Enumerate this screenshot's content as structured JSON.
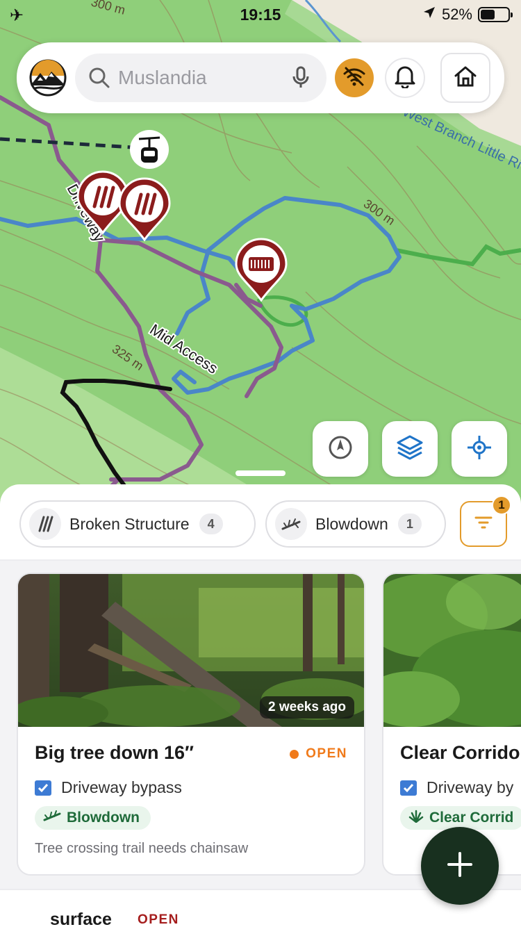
{
  "status_bar": {
    "time": "19:15",
    "battery": "52%",
    "battery_level": 0.52
  },
  "search": {
    "placeholder": "Muslandia",
    "value": ""
  },
  "map": {
    "labels": {
      "driveway": "Driveway",
      "mid_access": "Mid Access",
      "river": "West Branch Little River",
      "contour_300": "300 m",
      "contour_325": "325 m",
      "contour_top": "300 m"
    }
  },
  "filters": {
    "chips": [
      {
        "label": "Broken Structure",
        "count": "4",
        "icon": "broken-structure-icon"
      },
      {
        "label": "Blowdown",
        "count": "1",
        "icon": "blowdown-icon"
      }
    ],
    "active_count": "1"
  },
  "cards": [
    {
      "ago": "2 weeks ago",
      "title": "Big tree down 16″",
      "status": "OPEN",
      "trail": "Driveway bypass",
      "tag": "Blowdown",
      "tag_icon": "blowdown-icon",
      "description": "Tree crossing trail needs chainsaw"
    },
    {
      "title": "Clear Corrido",
      "trail": "Driveway by",
      "tag": "Clear Corrid",
      "tag_icon": "grass-icon"
    }
  ],
  "next_item": {
    "title": "surface",
    "status": "OPEN"
  },
  "colors": {
    "accent": "#e39b2b",
    "status_open": "#f07a1a",
    "fab": "#18301f",
    "marker": "#8b1c1c",
    "trail_blue": "#4a86c8",
    "trail_purple": "#8a5a8e",
    "trail_green": "#4cae4c"
  }
}
